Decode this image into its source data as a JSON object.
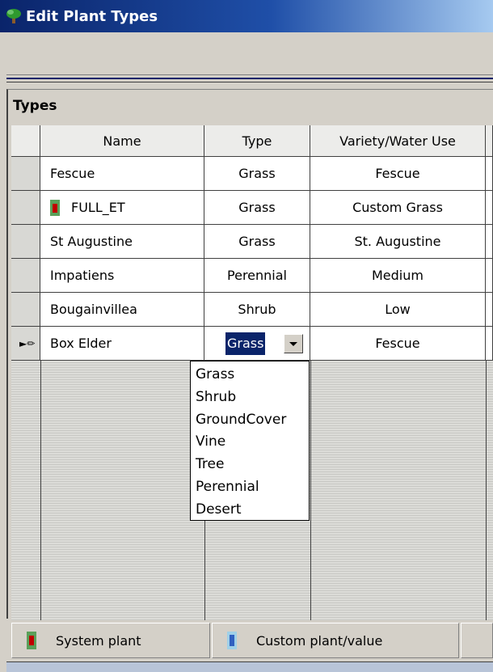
{
  "window": {
    "title": "Edit Plant Types"
  },
  "panel": {
    "title": "Types"
  },
  "table": {
    "columns": [
      "Name",
      "Type",
      "Variety/Water Use"
    ],
    "rows": [
      {
        "name": "Fescue",
        "type": "Grass",
        "variety": "Fescue",
        "system_plant": false
      },
      {
        "name": "FULL_ET",
        "type": "Grass",
        "variety": "Custom Grass",
        "system_plant": true
      },
      {
        "name": "St Augustine",
        "type": "Grass",
        "variety": "St. Augustine",
        "system_plant": false
      },
      {
        "name": "Impatiens",
        "type": "Perennial",
        "variety": "Medium",
        "system_plant": false
      },
      {
        "name": "Bougainvillea",
        "type": "Shrub",
        "variety": "Low",
        "system_plant": false
      },
      {
        "name": "Box Elder",
        "type": "Grass",
        "variety": "Fescue",
        "system_plant": false,
        "editing": true
      }
    ]
  },
  "type_dropdown": {
    "selected": "Grass",
    "options": [
      "Grass",
      "Shrub",
      "GroundCover",
      "Vine",
      "Tree",
      "Perennial",
      "Desert"
    ]
  },
  "legend": {
    "system_plant": "System plant",
    "custom_plant": "Custom plant/value"
  },
  "colors": {
    "title_bar": "#0a246a",
    "selection": "#0a246a",
    "system_icon_outer": "#5aa05a",
    "system_icon_inner": "#c00000",
    "custom_icon_outer": "#9fd0e8",
    "custom_icon_inner": "#3060c0"
  }
}
